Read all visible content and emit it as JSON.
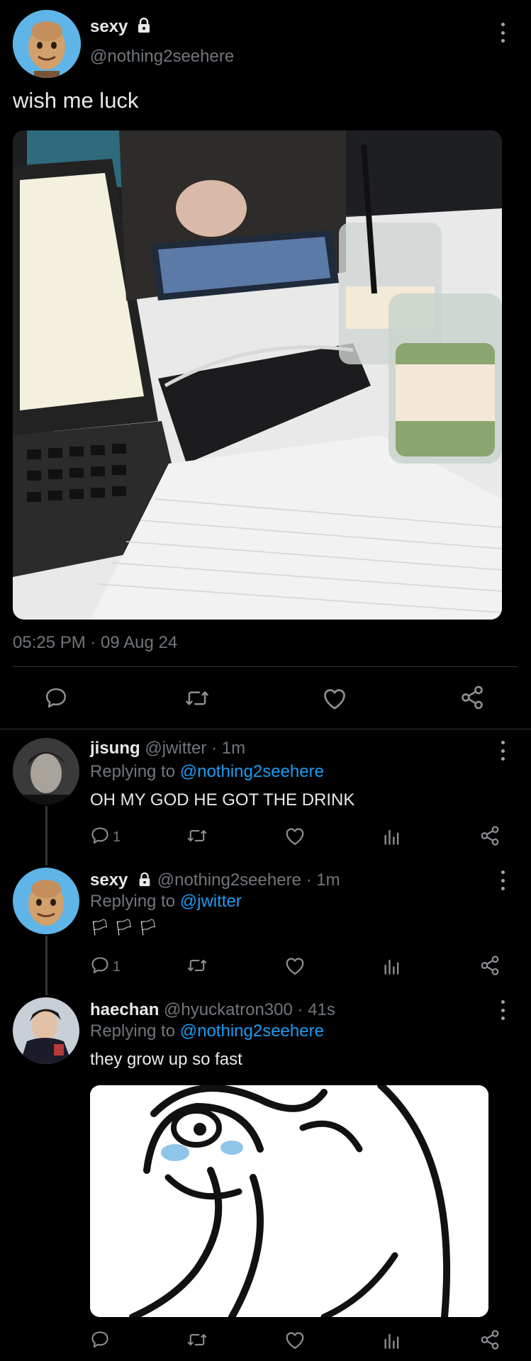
{
  "main_tweet": {
    "display_name": "sexy",
    "handle": "@nothing2seehere",
    "text": "wish me luck",
    "timestamp": "05:25 PM · 09 Aug 24",
    "avatar_desc": "3d-avatar",
    "actions": [
      "reply-icon",
      "retweet-icon",
      "like-icon",
      "share-icon"
    ]
  },
  "replies": [
    {
      "display_name": "jisung",
      "handle": "@jwitter",
      "time": "· 1m",
      "replying_prefix": "Replying to",
      "replying_to": "@nothing2seehere",
      "text": "OH MY GOD HE GOT THE DRINK",
      "reply_count": "1"
    },
    {
      "display_name": "sexy",
      "handle": "@nothing2seehere",
      "time": "· 1m",
      "replying_prefix": "Replying to",
      "replying_to": "@jwitter",
      "text": "🏳🏳🏳",
      "reply_count": "1"
    },
    {
      "display_name": "haechan",
      "handle": "@hyuckatron300",
      "time": "· 41s",
      "replying_prefix": "Replying to",
      "replying_to": "@nothing2seehere",
      "text": "they grow up so fast",
      "reply_count": ""
    }
  ],
  "colors": {
    "background": "#000000",
    "text": "#e7e9ea",
    "muted": "#71767b",
    "link": "#1d9bf0",
    "divider": "#2f3336"
  }
}
